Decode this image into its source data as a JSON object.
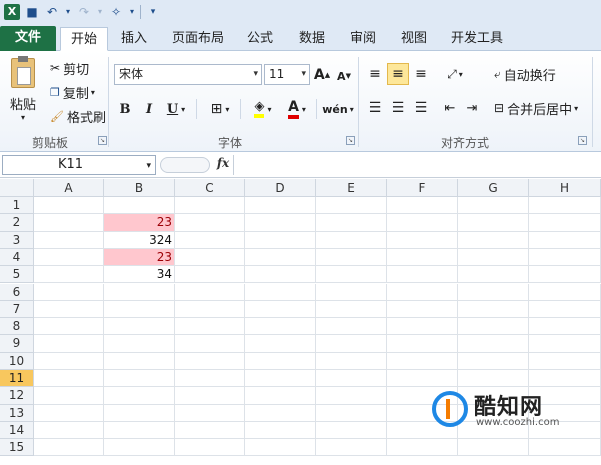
{
  "qat": {
    "icons": [
      "excel-logo",
      "save-icon",
      "undo-icon",
      "redo-icon",
      "wand-icon",
      "customize-icon"
    ]
  },
  "tabs": [
    {
      "label": "文件"
    },
    {
      "label": "开始"
    },
    {
      "label": "插入"
    },
    {
      "label": "页面布局"
    },
    {
      "label": "公式"
    },
    {
      "label": "数据"
    },
    {
      "label": "审阅"
    },
    {
      "label": "视图"
    },
    {
      "label": "开发工具"
    }
  ],
  "clipboard": {
    "paste": "粘贴",
    "cut": "剪切",
    "copy": "复制",
    "format_painter": "格式刷",
    "label": "剪贴板"
  },
  "font": {
    "name": "宋体",
    "size": "11",
    "bold": "B",
    "italic": "I",
    "underline": "U",
    "label": "字体",
    "grow": "A",
    "shrink": "A"
  },
  "alignment": {
    "wrap": "自动换行",
    "merge": "合并后居中",
    "label": "对齐方式"
  },
  "formula_bar": {
    "name_box": "K11",
    "fx": "fx",
    "formula": ""
  },
  "grid": {
    "columns": [
      "A",
      "B",
      "C",
      "D",
      "E",
      "F",
      "G",
      "H"
    ],
    "rows": [
      "1",
      "2",
      "3",
      "4",
      "5",
      "6",
      "7",
      "8",
      "9",
      "10",
      "11",
      "12",
      "13",
      "14",
      "15"
    ],
    "selected_row": "11",
    "b_values": {
      "2": "23",
      "3": "324",
      "4": "23",
      "5": "34"
    }
  },
  "watermark": {
    "title": "酷知网",
    "url": "www.coozhi.com"
  },
  "colors": {
    "file_tab": "#1e7145",
    "duplicate_fill": "#ffc7ce",
    "duplicate_text": "#9c0006",
    "selected_row_header": "#f8c75e"
  }
}
